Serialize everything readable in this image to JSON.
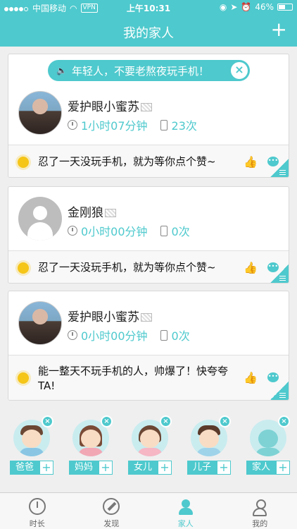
{
  "status_bar": {
    "carrier": "中国移动",
    "vpn": "VPN",
    "time": "上午10:31",
    "battery": "46%"
  },
  "nav": {
    "title": "我的家人",
    "add_symbol": "+"
  },
  "banner": {
    "text": "年轻人，不要老熬夜玩手机！"
  },
  "cards": [
    {
      "name": "爱护眼小蜜苏",
      "duration": "1小时07分钟",
      "count": "23次",
      "message": "忍了一天没玩手机，就为等你点个赞~"
    },
    {
      "name": "金刚狼",
      "duration": "0小时00分钟",
      "count": "0次",
      "message": "忍了一天没玩手机，就为等你点个赞~"
    },
    {
      "name": "爱护眼小蜜苏",
      "duration": "0小时00分钟",
      "count": "0次",
      "message": "能一整天不玩手机的人，帅爆了！快夸夸TA!"
    }
  ],
  "family": [
    {
      "label": "爸爸",
      "icon": "dad-avatar-icon"
    },
    {
      "label": "妈妈",
      "icon": "mom-avatar-icon"
    },
    {
      "label": "女儿",
      "icon": "daughter-avatar-icon"
    },
    {
      "label": "儿子",
      "icon": "son-avatar-icon"
    },
    {
      "label": "家人",
      "icon": "family-avatar-icon"
    }
  ],
  "tabs": [
    {
      "label": "时长",
      "icon": "clock-icon"
    },
    {
      "label": "发现",
      "icon": "compass-icon"
    },
    {
      "label": "家人",
      "icon": "people-icon",
      "active": true
    },
    {
      "label": "我的",
      "icon": "person-icon"
    }
  ],
  "colors": {
    "accent": "#4ec9cd",
    "bulb": "#f5c518"
  }
}
